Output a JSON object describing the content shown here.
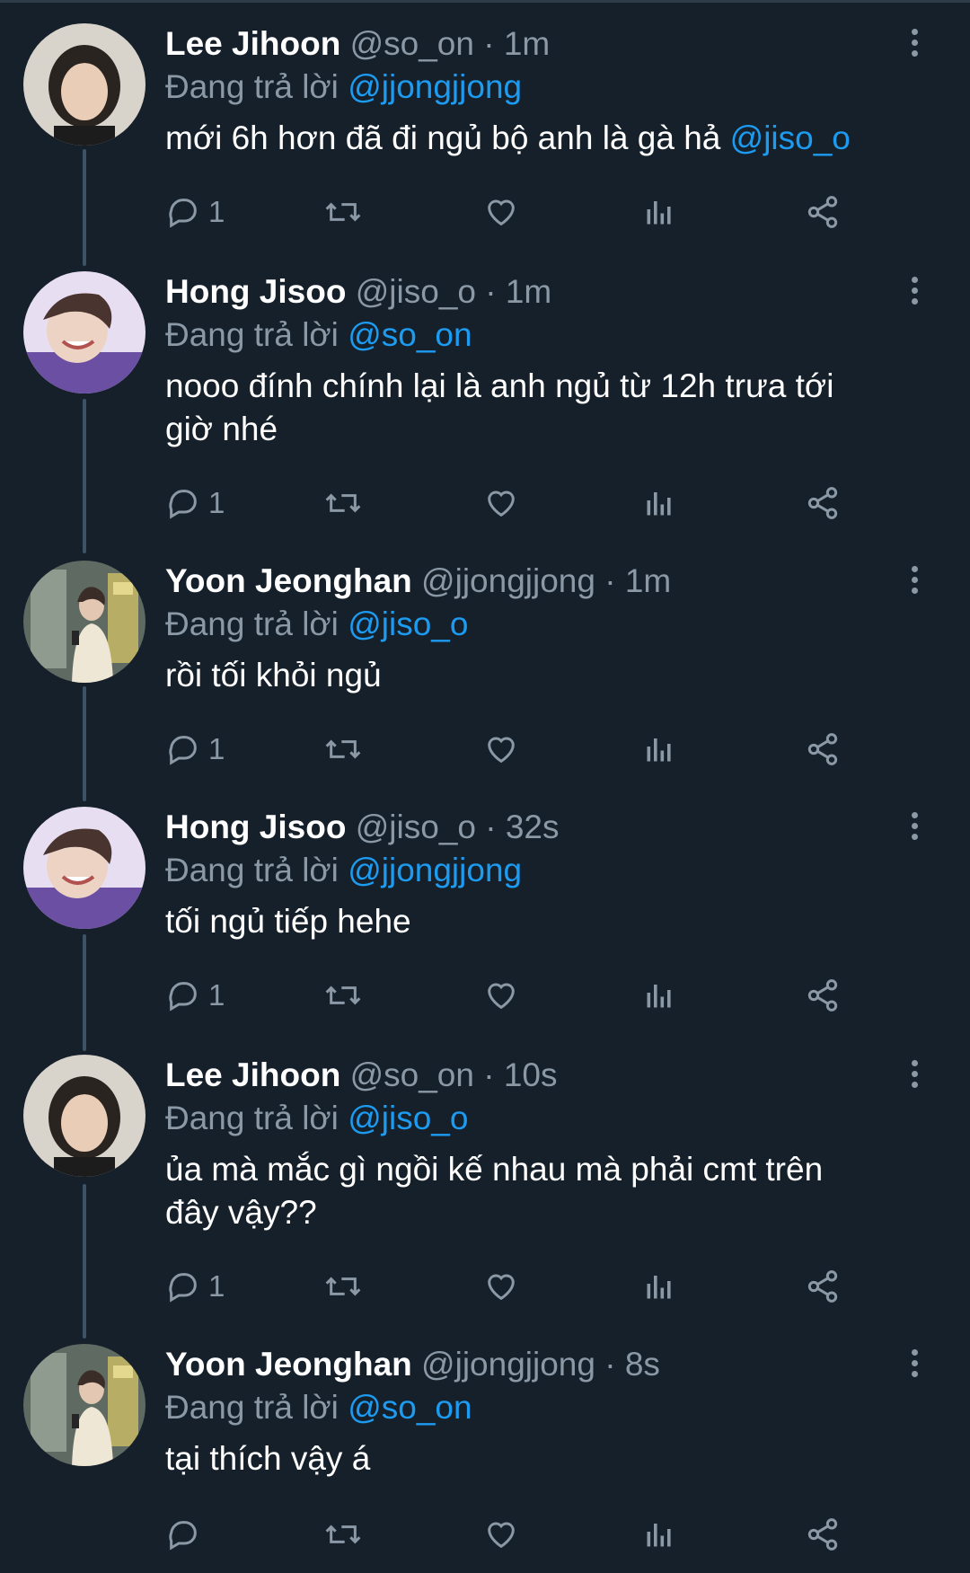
{
  "tweets": [
    {
      "name": "Lee Jihoon",
      "handle": "@so_on",
      "sep": "·",
      "time": "1m",
      "replying_prefix": "Đang trả lời ",
      "replying_to": "@jjongjjong",
      "text_lines": [
        "mới 6h hơn đã đi ngủ bộ anh là gà hả "
      ],
      "text_mention": "@jiso_o",
      "reply_count": "1",
      "avatar": "avatar-lee-jihoon"
    },
    {
      "name": "Hong Jisoo",
      "handle": "@jiso_o",
      "sep": "·",
      "time": "1m",
      "replying_prefix": "Đang trả lời ",
      "replying_to": "@so_on",
      "text_lines": [
        "nooo đính chính lại là anh ngủ từ 12h trưa tới",
        "giờ nhé"
      ],
      "reply_count": "1",
      "avatar": "avatar-hong-jisoo"
    },
    {
      "name": "Yoon Jeonghan",
      "handle": "@jjongjjong",
      "sep": "·",
      "time": "1m",
      "replying_prefix": "Đang trả lời ",
      "replying_to": "@jiso_o",
      "text_lines": [
        "rồi tối khỏi ngủ"
      ],
      "reply_count": "1",
      "avatar": "avatar-yoon-jeonghan"
    },
    {
      "name": "Hong Jisoo",
      "handle": "@jiso_o",
      "sep": "·",
      "time": "32s",
      "replying_prefix": "Đang trả lời ",
      "replying_to": "@jjongjjong",
      "text_lines": [
        "tối ngủ tiếp hehe"
      ],
      "reply_count": "1",
      "avatar": "avatar-hong-jisoo"
    },
    {
      "name": "Lee Jihoon",
      "handle": "@so_on",
      "sep": "·",
      "time": "10s",
      "replying_prefix": "Đang trả lời ",
      "replying_to": "@jiso_o",
      "text_lines": [
        "ủa mà mắc gì ngồi kế nhau mà phải cmt trên",
        "đây vậy??"
      ],
      "reply_count": "1",
      "avatar": "avatar-lee-jihoon"
    },
    {
      "name": "Yoon Jeonghan",
      "handle": "@jjongjjong",
      "sep": "·",
      "time": "8s",
      "replying_prefix": "Đang trả lời ",
      "replying_to": "@so_on",
      "text_lines": [
        "tại thích vậy á"
      ],
      "reply_count": "",
      "avatar": "avatar-yoon-jeonghan"
    }
  ],
  "icons": {
    "reply": "reply-icon",
    "retweet": "retweet-icon",
    "like": "heart-icon",
    "views": "analytics-icon",
    "share": "share-icon",
    "more": "more-options-icon"
  },
  "colors": {
    "background": "#15202b",
    "secondary_text": "#8b98a5",
    "link": "#1d9bf0",
    "thread_line": "#3d5466"
  }
}
